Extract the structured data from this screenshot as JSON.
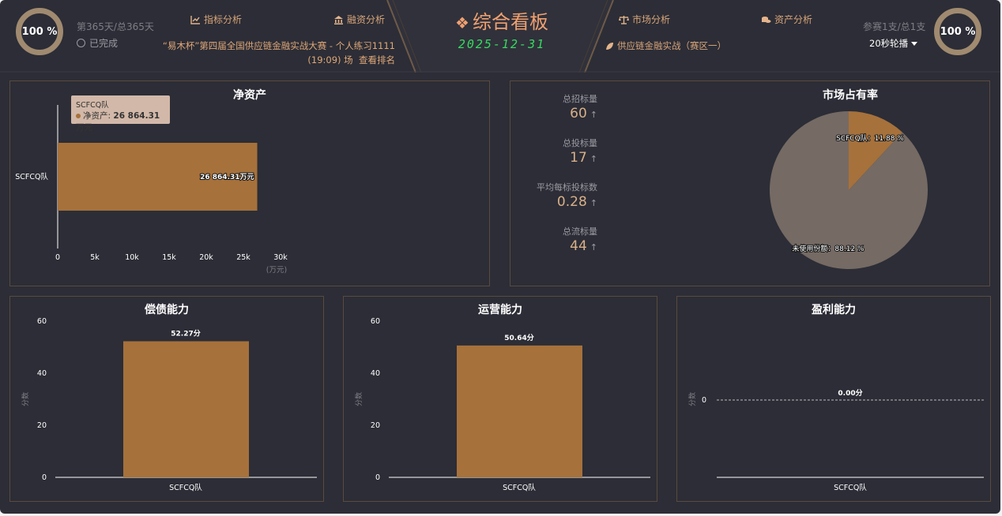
{
  "header": {
    "progress_left": "100 %",
    "day_text": "第365天/总365天",
    "done_label": "已完成",
    "nav_left": [
      {
        "label": "指标分析"
      },
      {
        "label": "融资分析"
      }
    ],
    "nav_right": [
      {
        "label": "市场分析"
      },
      {
        "label": "资产分析"
      }
    ],
    "competition_line1": "“易木杯”第四届全国供应链金融实战大赛 - 个人练习1111",
    "competition_line2": "(19:09) 场",
    "view_ranking": "查看排名",
    "title": "综合看板",
    "date": "2025-12-31",
    "region": "供应链金融实战（赛区一）",
    "participants": "参赛1支/总1支",
    "rotation": "20秒轮播",
    "progress_right": "100 %"
  },
  "net_assets": {
    "title": "净资产",
    "tooltip_team": "SCFCQ队",
    "tooltip_label": "净资产:",
    "tooltip_value": "26 864.31万元",
    "unit": "(万元)"
  },
  "market": {
    "title": "市场占有率",
    "stats": [
      {
        "label": "总招标量",
        "value": "60",
        "arrow": "↑"
      },
      {
        "label": "总投标量",
        "value": "17",
        "arrow": "↑"
      },
      {
        "label": "平均每标投标数",
        "value": "0.28",
        "arrow": "↑"
      },
      {
        "label": "总流标量",
        "value": "44",
        "arrow": "↑"
      }
    ]
  },
  "solvency": {
    "title": "偿债能力",
    "ylabel": "分数"
  },
  "operation": {
    "title": "运营能力",
    "ylabel": "分数"
  },
  "profit": {
    "title": "盈利能力",
    "ylabel": "分数"
  },
  "colors": {
    "bar": "#a6713b",
    "pie_used": "#a6713b",
    "pie_unused": "#756a64",
    "accent": "#f0a070",
    "date": "#38d860"
  },
  "chart_data": [
    {
      "type": "bar",
      "orientation": "horizontal",
      "categories": [
        "SCFCQ队"
      ],
      "values": [
        26864.31
      ],
      "data_labels": [
        "26 864.31万元"
      ],
      "xlim": [
        0,
        30000
      ],
      "x_ticks": [
        "0",
        "5k",
        "10k",
        "15k",
        "20k",
        "25k",
        "30k"
      ],
      "xlabel": "(万元)"
    },
    {
      "type": "pie",
      "slices": [
        {
          "name": "SCFCQ队",
          "value": 11.88,
          "label": "SCFCQ队：11.88 %"
        },
        {
          "name": "未使用份额",
          "value": 88.12,
          "label": "未使用份额：88.12 %"
        }
      ]
    },
    {
      "type": "bar",
      "categories": [
        "SCFCQ队"
      ],
      "values": [
        52.27
      ],
      "data_labels": [
        "52.27分"
      ],
      "ylim": [
        0,
        60
      ],
      "y_ticks": [
        "0",
        "20",
        "40",
        "60"
      ],
      "ylabel": "分数"
    },
    {
      "type": "bar",
      "categories": [
        "SCFCQ队"
      ],
      "values": [
        50.64
      ],
      "data_labels": [
        "50.64分"
      ],
      "ylim": [
        0,
        60
      ],
      "y_ticks": [
        "0",
        "20",
        "40",
        "60"
      ],
      "ylabel": "分数"
    },
    {
      "type": "bar",
      "categories": [
        "SCFCQ队"
      ],
      "values": [
        0.0
      ],
      "data_labels": [
        "0.00分"
      ],
      "y_ticks": [
        "0"
      ],
      "ylabel": "分数"
    }
  ]
}
